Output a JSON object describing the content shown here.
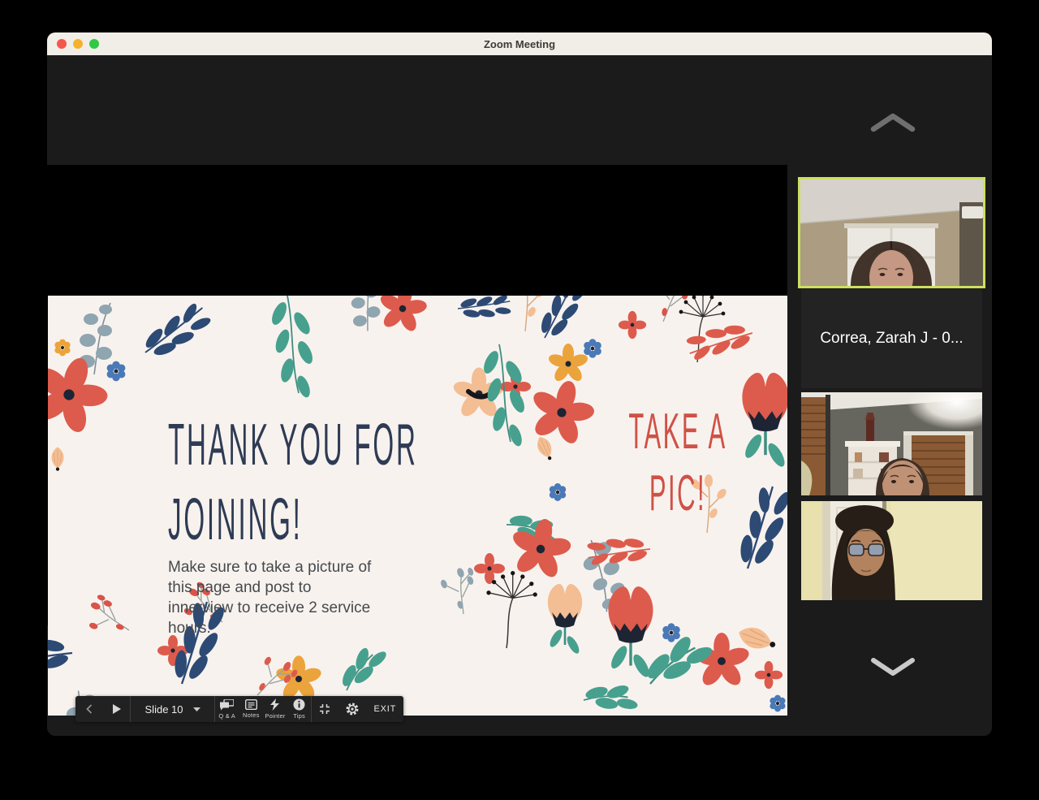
{
  "window": {
    "title": "Zoom Meeting"
  },
  "slide": {
    "title_line1": "THANK YOU FOR",
    "title_line2": "JOINING!",
    "body_lines": [
      "Make sure to take a picture of",
      "this page and post to",
      "innerview to receive 2 service",
      "hours."
    ],
    "cta_line1": "TAKE A",
    "cta_line2": "PIC!"
  },
  "presenter_toolbar": {
    "slide_label": "Slide 10",
    "qa_label": "Q & A",
    "notes_label": "Notes",
    "pointer_label": "Pointer",
    "tips_label": "Tips",
    "exit_label": "EXIT"
  },
  "sidebar": {
    "name_tile_label": "Correa, Zarah J - 0..."
  },
  "colors": {
    "active_speaker_border": "#cde05e",
    "slide_background": "#f8f2ee",
    "slide_title": "#2e3b54",
    "slide_cta": "#cf5146",
    "toolbar_background": "#212121",
    "titlebar_background": "#f1eee8"
  }
}
